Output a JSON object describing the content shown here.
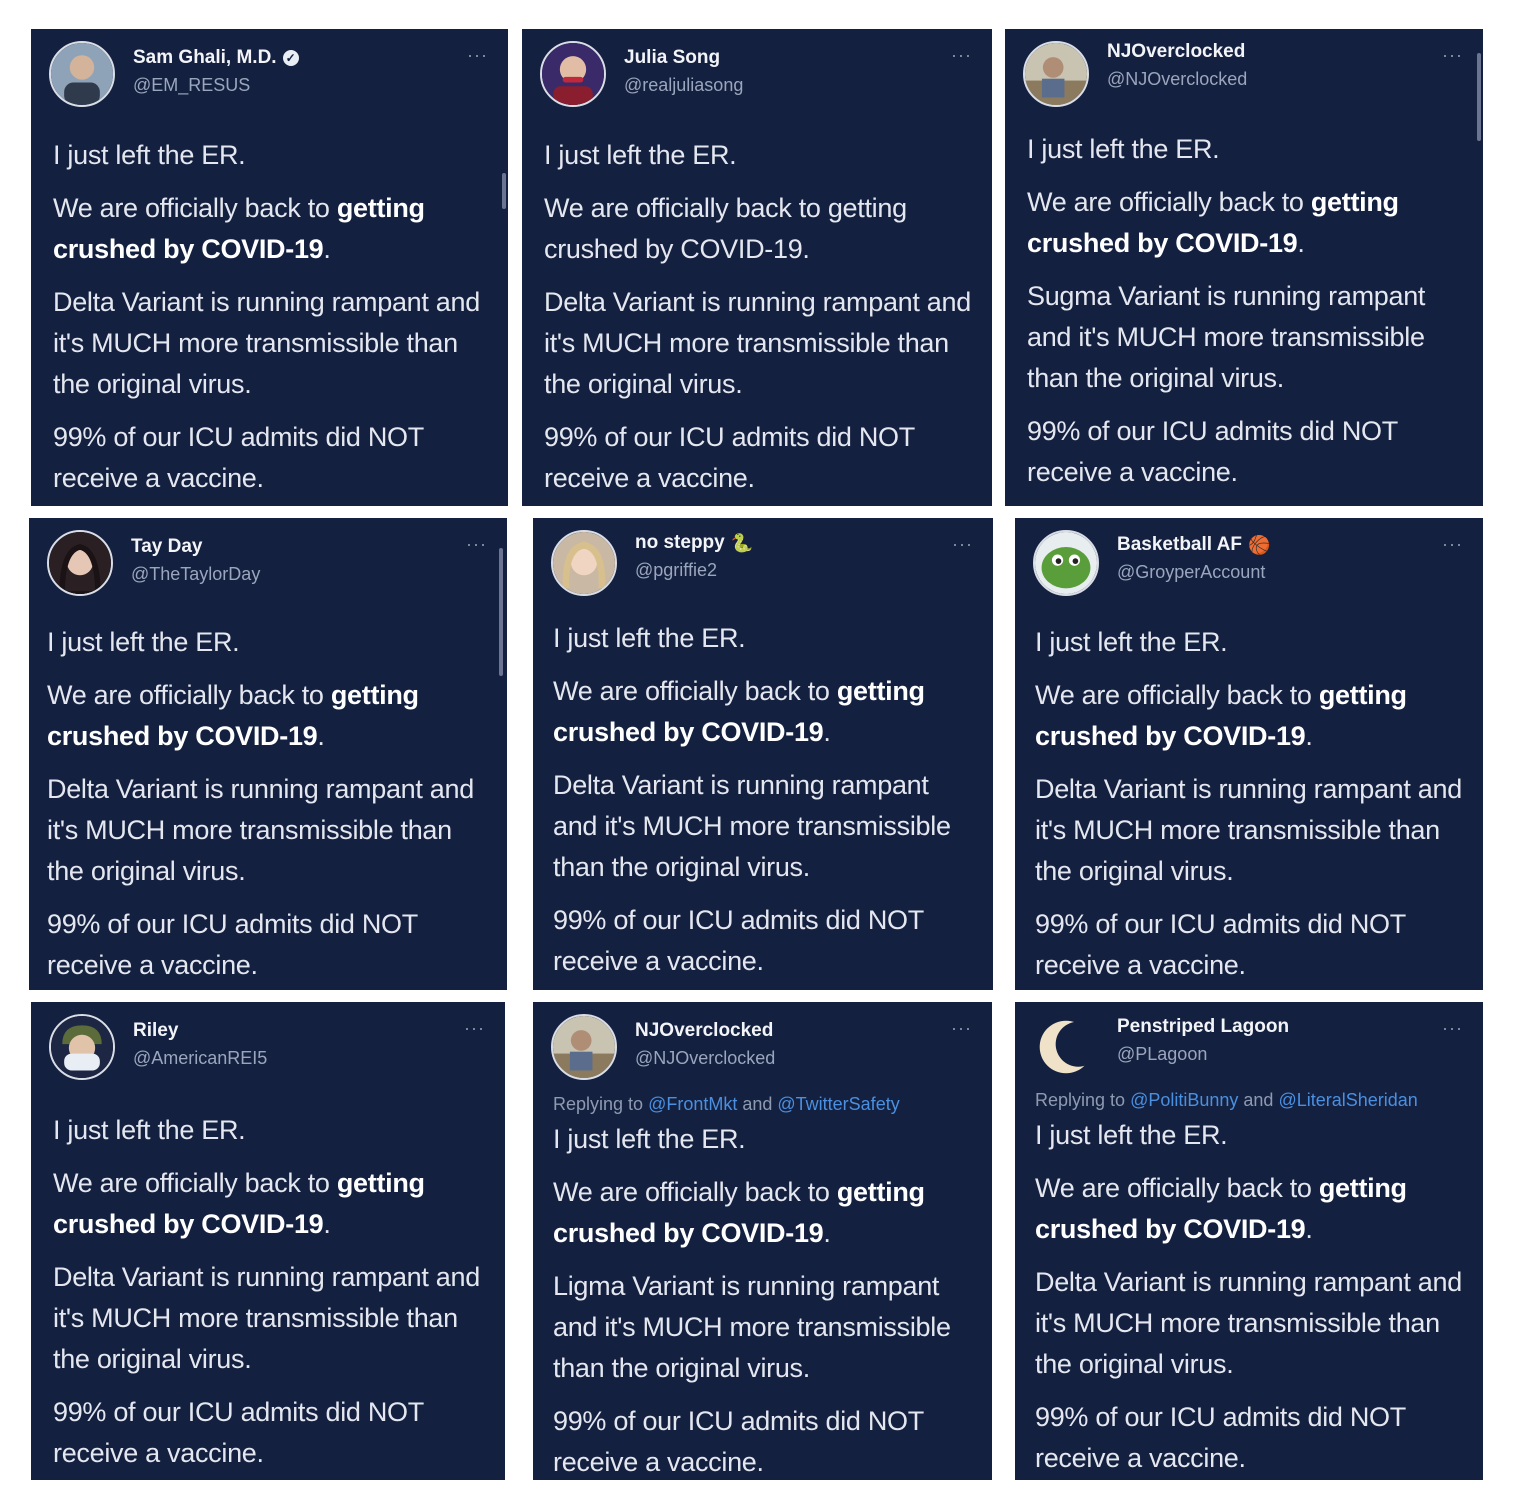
{
  "tweets": [
    {
      "name": "Sam Ghali, M.D.",
      "handle": "@EM_RESUS",
      "verified": true,
      "emoji": "",
      "more": "···",
      "reply": null,
      "lines": {
        "p1": "I just left the ER.",
        "p2a": "We are officially back to ",
        "p2b": "getting crushed by COVID-19",
        "p2c": ".",
        "p3": "Delta Variant is running rampant and it's MUCH more transmissible than the original virus.",
        "p4": "99% of our ICU admits did NOT receive a vaccine."
      }
    },
    {
      "name": "Julia Song",
      "handle": "@realjuliasong",
      "verified": false,
      "emoji": "",
      "more": "···",
      "reply": null,
      "lines": {
        "p1": "I just left the ER.",
        "p2a": "We are officially back to getting crushed by COVID-19.",
        "p2b": "",
        "p2c": "",
        "p3": "Delta Variant is running rampant and it's MUCH more transmissible than the original virus.",
        "p4": "99% of our ICU admits did NOT receive a vaccine."
      }
    },
    {
      "name": "NJOverclocked",
      "handle": "@NJOverclocked",
      "verified": false,
      "emoji": "",
      "more": "···",
      "reply": null,
      "lines": {
        "p1": "I just left the ER.",
        "p2a": "We are officially back to ",
        "p2b": "getting crushed by COVID-19",
        "p2c": ".",
        "p3": "Sugma Variant is running rampant and it's MUCH more transmissible than the original virus.",
        "p4": "99% of our ICU admits did NOT receive a vaccine."
      }
    },
    {
      "name": "Tay Day",
      "handle": "@TheTaylorDay",
      "verified": false,
      "emoji": "",
      "more": "···",
      "reply": null,
      "lines": {
        "p1": "I just left the ER.",
        "p2a": "We are officially back to ",
        "p2b": "getting crushed by COVID-19",
        "p2c": ".",
        "p3": "Delta Variant is running rampant and it's MUCH more transmissible than the original virus.",
        "p4": "99% of our ICU admits did NOT receive a vaccine."
      }
    },
    {
      "name": "no steppy",
      "handle": "@pgriffie2",
      "verified": false,
      "emoji": "🐍",
      "more": "···",
      "reply": null,
      "lines": {
        "p1": "I just left the ER.",
        "p2a": "We are officially back to ",
        "p2b": "getting crushed by COVID-19",
        "p2c": ".",
        "p3": "Delta Variant is running rampant and it's MUCH more transmissible than the original virus.",
        "p4": "99% of our ICU admits did NOT receive a vaccine."
      }
    },
    {
      "name": "Basketball AF",
      "handle": "@GroyperAccount",
      "verified": false,
      "emoji": "🏀",
      "more": "···",
      "reply": null,
      "lines": {
        "p1": "I just left the ER.",
        "p2a": "We are officially back to ",
        "p2b": "getting crushed by COVID-19",
        "p2c": ".",
        "p3": "Delta Variant is running rampant and it's MUCH more transmissible than the original virus.",
        "p4": "99% of our ICU admits did NOT receive a vaccine."
      }
    },
    {
      "name": "Riley",
      "handle": "@AmericanREI5",
      "verified": false,
      "emoji": "",
      "more": "···",
      "reply": null,
      "lines": {
        "p1": "I just left the ER.",
        "p2a": "We are officially back to ",
        "p2b": "getting crushed by COVID-19",
        "p2c": ".",
        "p3": "Delta Variant is running rampant and it's MUCH more transmissible than the original virus.",
        "p4": "99% of our ICU admits did NOT receive a vaccine."
      }
    },
    {
      "name": "NJOverclocked",
      "handle": "@NJOverclocked",
      "verified": false,
      "emoji": "",
      "more": "···",
      "reply": {
        "prefix": "Replying to ",
        "m1": "@FrontMkt",
        "and": " and ",
        "m2": "@TwitterSafety"
      },
      "lines": {
        "p1": "I just left the ER.",
        "p2a": "We are officially back to ",
        "p2b": "getting crushed by COVID-19",
        "p2c": ".",
        "p3": "Ligma Variant is running rampant and it's MUCH more transmissible than the original virus.",
        "p4": "99% of our ICU admits did NOT receive a vaccine."
      }
    },
    {
      "name": "Penstriped Lagoon",
      "handle": "@PLagoon",
      "verified": false,
      "emoji": "",
      "more": "···",
      "reply": {
        "prefix": "Replying to ",
        "m1": "@PolitiBunny",
        "and": " and ",
        "m2": "@LiteralSheridan"
      },
      "lines": {
        "p1": "I just left the ER.",
        "p2a": "We are officially back to ",
        "p2b": "getting crushed by COVID-19",
        "p2c": ".",
        "p3": "Delta Variant is running rampant and it's MUCH more transmissible than the original virus.",
        "p4": "99% of our ICU admits did NOT receive a vaccine."
      }
    }
  ],
  "colors": {
    "tweet_bg": "#14203f",
    "text": "#e4e7ef",
    "handle": "#9aa6bd",
    "mention": "#4a8fe0"
  },
  "avatars": [
    "doctor-photo",
    "woman-red-lips",
    "man-photo",
    "woman-dark-hair",
    "blonde-woman",
    "green-frog",
    "masked-soldier",
    "man-photo",
    "crescent-moon"
  ]
}
